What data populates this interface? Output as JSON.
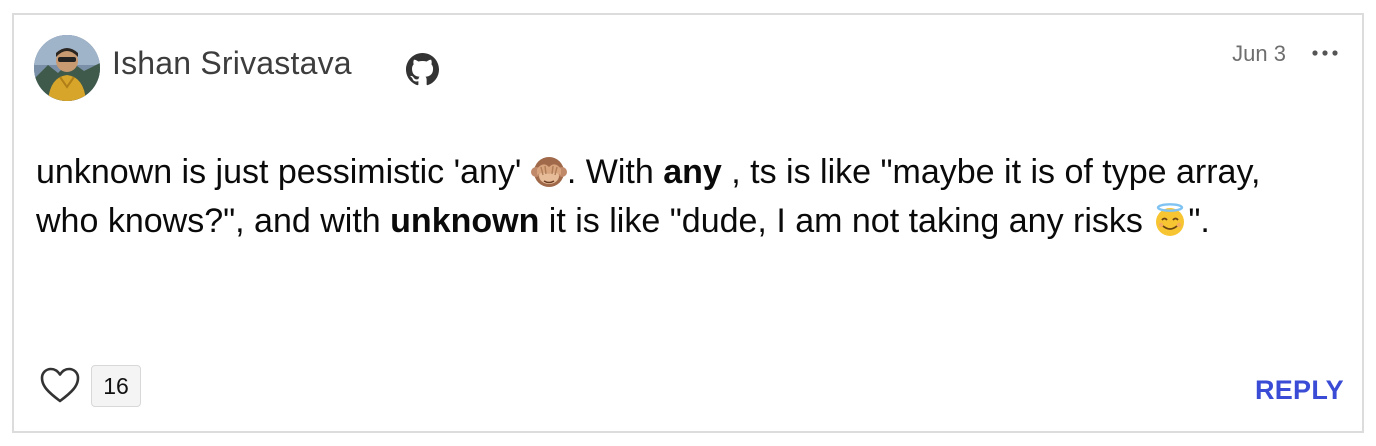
{
  "comment": {
    "author": "Ishan Srivastava",
    "date": "Jun 3",
    "body": {
      "p1": "unknown is just pessimistic 'any' ",
      "p2": ". With ",
      "b1": "any",
      "p3": " , ts is like \"maybe it is of type array, who knows?\", and with ",
      "b2": "unknown",
      "p4": " it is like \"dude, I am not taking any risks ",
      "p5": "\"."
    },
    "likes": "16",
    "reply_label": "REPLY"
  },
  "icons": {
    "avatar": "user-avatar",
    "github": "github-icon",
    "more": "more-options-icon",
    "see_no_evil": "see-no-evil-monkey-emoji",
    "halo": "smiling-face-with-halo-emoji",
    "heart": "heart-icon"
  },
  "colors": {
    "accent": "#3a4bd6",
    "border": "#dcdcdc",
    "muted_text": "#6e6e6e"
  }
}
